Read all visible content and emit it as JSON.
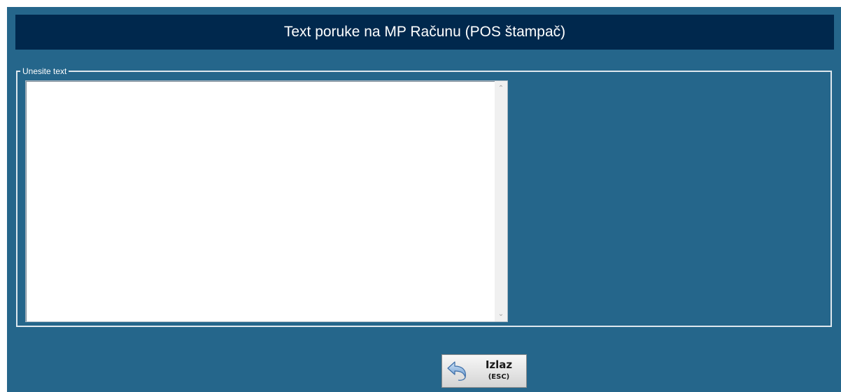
{
  "window": {
    "title": "Text poruke na MP Računu (POS štampač)"
  },
  "message_group": {
    "legend": "Unesite text",
    "textarea_value": ""
  },
  "exit_button": {
    "label": "Izlaz",
    "shortcut": "(ESC)",
    "icon": "undo-arrow-icon"
  },
  "colors": {
    "window_bg": "#25668b",
    "title_bg": "#00284d",
    "title_text": "#ffffff",
    "group_border": "#dfe8ee"
  }
}
